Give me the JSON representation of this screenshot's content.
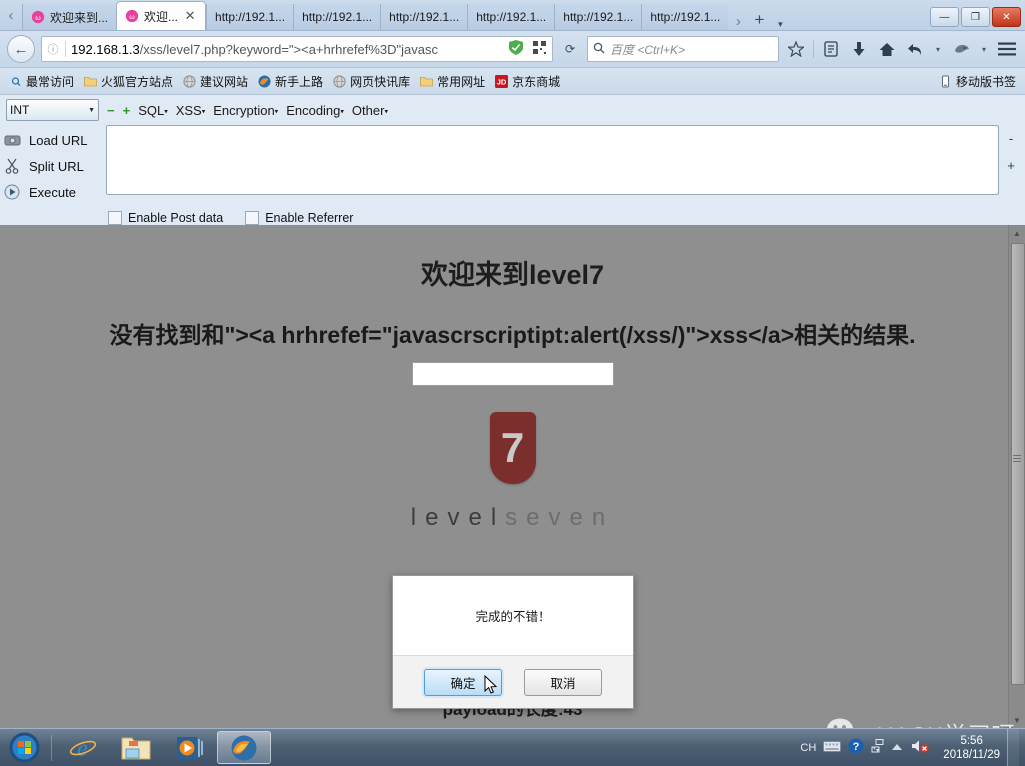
{
  "browser": {
    "tabs": [
      {
        "title": "欢迎来到...",
        "active": false,
        "favicon": "xss-flower-icon"
      },
      {
        "title": "欢迎...",
        "active": true,
        "favicon": "xss-flower-icon"
      },
      {
        "title": "http://192.1...",
        "active": false,
        "favicon": "none"
      },
      {
        "title": "http://192.1...",
        "active": false,
        "favicon": "none"
      },
      {
        "title": "http://192.1...",
        "active": false,
        "favicon": "none"
      },
      {
        "title": "http://192.1...",
        "active": false,
        "favicon": "none"
      },
      {
        "title": "http://192.1...",
        "active": false,
        "favicon": "none"
      },
      {
        "title": "http://192.1...",
        "active": false,
        "favicon": "none"
      }
    ],
    "tab_close_label": "✕",
    "tab_scroll_left": "‹",
    "tab_scroll_right": "›",
    "new_tab_label": "+",
    "tab_list_menu": "▾",
    "window_buttons": {
      "minimize": "—",
      "restore": "❐",
      "close": "✕"
    },
    "nav": {
      "back_label": "←",
      "url_host": "192.168.1.3",
      "url_path": "/xss/level7.php?keyword=\"><a+hrhrefef%3D\"javasc",
      "identity_icon": "info-circle-icon",
      "shield_icon": "shield-icon",
      "qr_icon": "qrcode-icon",
      "reload_label": "⟳",
      "search_placeholder": "百度 <Ctrl+K>",
      "search_icon": "magnifier-icon",
      "bookmark_icon": "star-icon",
      "reader_icon": "reader-list-icon",
      "downloads_icon": "download-arrow-icon",
      "home_icon": "home-icon",
      "history_icon": "back-arrow-history-icon",
      "dropdown_icon": "chevron-down-icon",
      "addon_icon": "fox-addon-icon",
      "menu_icon": "hamburger-menu-icon"
    },
    "bookmarks": [
      {
        "label": "最常访问",
        "icon": "most-visited-icon"
      },
      {
        "label": "火狐官方站点",
        "icon": "folder-icon"
      },
      {
        "label": "建议网站",
        "icon": "globe-icon"
      },
      {
        "label": "新手上路",
        "icon": "firefox-icon"
      },
      {
        "label": "网页快讯库",
        "icon": "globe-icon"
      },
      {
        "label": "常用网址",
        "icon": "folder-icon"
      },
      {
        "label": "京东商城",
        "icon": "jd-icon"
      }
    ],
    "mobile_bookmarks": {
      "label": "移动版书签",
      "icon": "phone-icon"
    }
  },
  "hackbar": {
    "select_value": "INT",
    "select_caret": "▼",
    "minus_label": "−",
    "plus_label": "+",
    "menus": [
      "SQL",
      "XSS",
      "Encryption",
      "Encoding",
      "Other"
    ],
    "menu_caret": "▾",
    "buttons": [
      {
        "label": "Load URL",
        "icon": "load-url-icon"
      },
      {
        "label": "Split URL",
        "icon": "scissors-icon"
      },
      {
        "label": "Execute",
        "icon": "play-circle-icon"
      }
    ],
    "textarea_value": "",
    "checkboxes": [
      {
        "label": "Enable Post data",
        "checked": false
      },
      {
        "label": "Enable Referrer",
        "checked": false
      }
    ],
    "zoom_out": "-",
    "zoom_in": "+"
  },
  "page": {
    "title": "欢迎来到level7",
    "message": "没有找到和\"><a hrhrefef=\"javascrscriptipt:alert(/xss/)\">xss</a>相关的结果.",
    "badge_number": "7",
    "level_word_a": "level",
    "level_word_b": "seven",
    "payload_length": "payload的长度:43",
    "scroll_up": "▲",
    "scroll_down": "▼"
  },
  "dialog": {
    "message": "完成的不错！",
    "ok_label": "确定",
    "cancel_label": "取消"
  },
  "watermark": {
    "text": "HACK学习呀",
    "icon": "wechat-icon"
  },
  "taskbar": {
    "start_icon": "windows-start-orb",
    "items": [
      {
        "icon": "internet-explorer-icon",
        "active": false
      },
      {
        "icon": "file-explorer-icon",
        "active": false
      },
      {
        "icon": "media-player-icon",
        "active": false
      },
      {
        "icon": "firefox-icon",
        "active": true
      }
    ],
    "tray": {
      "ime": "CH",
      "keyboard_icon": "keyboard-icon",
      "help_icon": "help-blue-icon",
      "network_icon": "network-icon",
      "overflow_icon": "show-hidden-icons-icon",
      "volume_icon": "volume-muted-icon"
    },
    "clock": {
      "time": "5:56",
      "date": "2018/11/29"
    }
  },
  "colors": {
    "page_bg": "#8f8f8f",
    "badge": "#7b2f2c",
    "accent_blue": "#5b9bd5"
  }
}
